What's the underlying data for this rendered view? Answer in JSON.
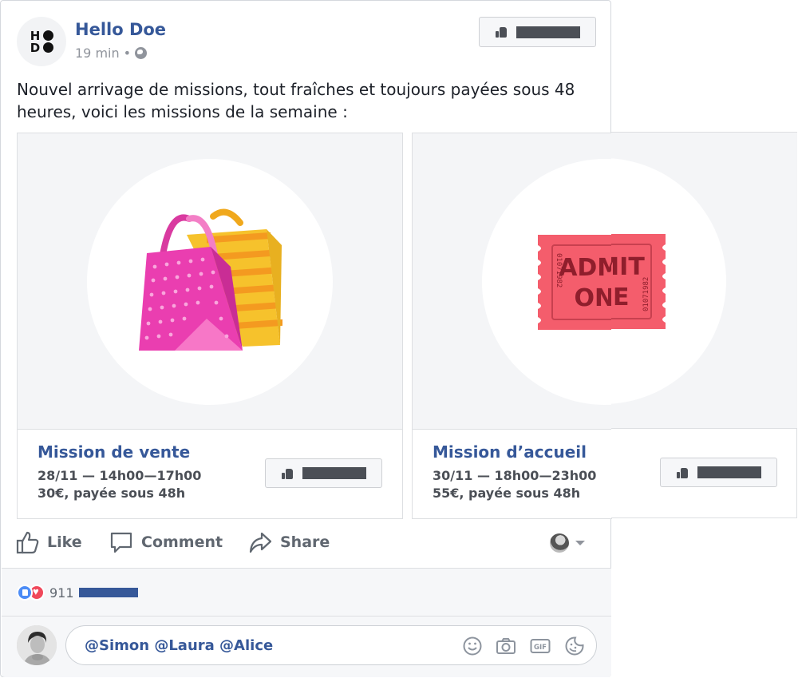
{
  "post": {
    "author": "Hello Doe",
    "time": "19 min",
    "separator": "•",
    "logo_letters": [
      "H",
      "D"
    ],
    "text": "Nouvel arrivage de missions, tout fraîches et toujours payées sous 48 heures, voici les missions de la semaine :"
  },
  "cards": [
    {
      "title": "Mission de vente",
      "date_line": "28/11 — 14h00—17h00",
      "pay_line": "30€, payée sous 48h",
      "image_icon": "shopping-bags-icon"
    },
    {
      "title": "Mission d’accueil",
      "date_line": "30/11 — 18h00—23h00",
      "pay_line": "55€, payée sous 48h",
      "image_icon": "admit-one-ticket-icon",
      "ticket_text_top": "ADMIT",
      "ticket_text_bottom": "ONE",
      "ticket_serial": "01071982"
    }
  ],
  "actions": {
    "like": "Like",
    "comment": "Comment",
    "share": "Share"
  },
  "reactions": {
    "count": "911"
  },
  "comment": {
    "text": "@Simon @Laura @Alice"
  },
  "colors": {
    "link_blue": "#365899",
    "muted": "#90949c",
    "card_bg": "#f4f5f7",
    "like_blue": "#4c8cf6",
    "love_red": "#f0485b"
  }
}
